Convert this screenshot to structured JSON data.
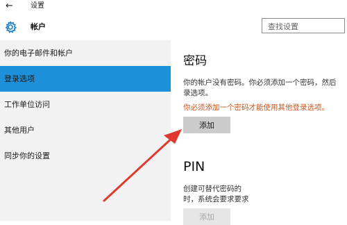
{
  "titlebar": {
    "back_icon": "back-arrow-icon",
    "title": "设置"
  },
  "header": {
    "icon": "gear-icon",
    "title": "帐户"
  },
  "search": {
    "placeholder": "查找设置"
  },
  "sidebar": {
    "items": [
      {
        "label": "你的电子邮件和帐户",
        "active": false
      },
      {
        "label": "登录选项",
        "active": true
      },
      {
        "label": "工作单位访问",
        "active": false
      },
      {
        "label": "其他用户",
        "active": false
      },
      {
        "label": "同步你的设置",
        "active": false
      }
    ]
  },
  "password": {
    "heading": "密码",
    "description_line1": "你的帐户没有密码。你必须添加一个密码，然后",
    "description_line2": "录选项。",
    "warning": "你必须添加一个密码才能使用其他登录选项。",
    "add_label": "添加"
  },
  "pin": {
    "heading": "PIN",
    "description_line1": "创建可替代密码的",
    "description_line2": "时，系统会要求要求",
    "add_label": "添加"
  },
  "colors": {
    "accent": "#1e90d9",
    "sidebar_bg": "#f2f2f2",
    "warning_text": "#c8561a",
    "annotation_arrow": "#e03a2e",
    "button_bg": "#cccccc"
  }
}
